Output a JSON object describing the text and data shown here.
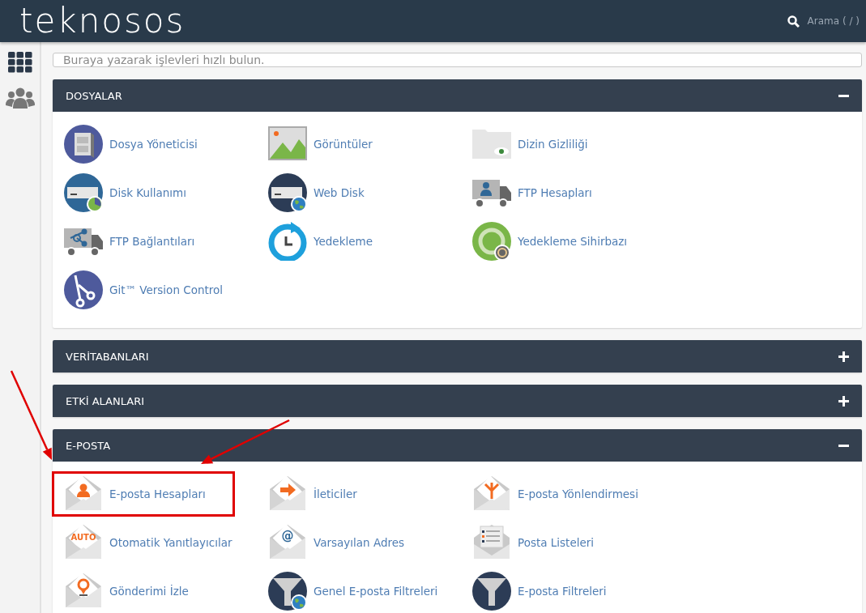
{
  "header": {
    "logo": "teknosos",
    "search_label": "Arama ( / )"
  },
  "search": {
    "placeholder": "Buraya yazarak işlevleri hızlı bulun."
  },
  "sections": [
    {
      "title": "DOSYALAR",
      "expanded": true,
      "items": [
        {
          "label": "Dosya Yöneticisi",
          "highlighted": false
        },
        {
          "label": "Görüntüler",
          "highlighted": false
        },
        {
          "label": "Dizin Gizliliği",
          "highlighted": false
        },
        {
          "label": "Disk Kullanımı",
          "highlighted": false
        },
        {
          "label": "Web Disk",
          "highlighted": false
        },
        {
          "label": "FTP Hesapları",
          "highlighted": false
        },
        {
          "label": "FTP Bağlantıları",
          "highlighted": false
        },
        {
          "label": "Yedekleme",
          "highlighted": false
        },
        {
          "label": "Yedekleme Sihirbazı",
          "highlighted": false
        },
        {
          "label": "Git™ Version Control",
          "highlighted": false
        }
      ]
    },
    {
      "title": "VERİTABANLARI",
      "expanded": false
    },
    {
      "title": "ETKİ ALANLARI",
      "expanded": false
    },
    {
      "title": "E-POSTA",
      "expanded": true,
      "items": [
        {
          "label": "E-posta Hesapları",
          "highlighted": true
        },
        {
          "label": "İleticiler",
          "highlighted": false
        },
        {
          "label": "E-posta Yönlendirmesi",
          "highlighted": false
        },
        {
          "label": "Otomatik Yanıtlayıcılar",
          "highlighted": false,
          "icon_text": "AUTO"
        },
        {
          "label": "Varsayılan Adres",
          "highlighted": false,
          "icon_text": "@"
        },
        {
          "label": "Posta Listeleri",
          "highlighted": false
        },
        {
          "label": "Gönderimi İzle",
          "highlighted": false
        },
        {
          "label": "Genel E-posta Filtreleri",
          "highlighted": false
        },
        {
          "label": "E-posta Filtreleri",
          "highlighted": false
        }
      ]
    }
  ]
}
